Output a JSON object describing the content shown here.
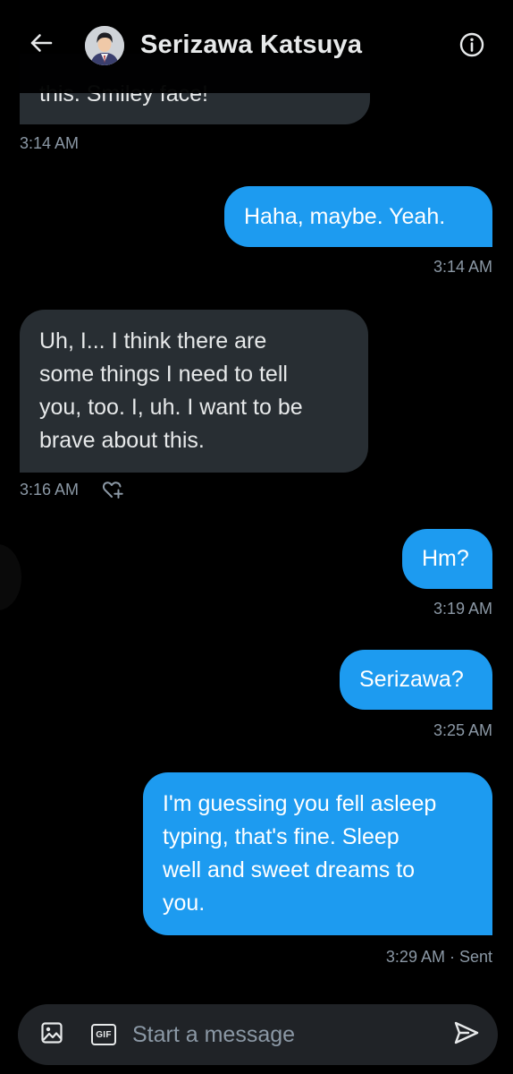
{
  "header": {
    "contact_name": "Serizawa Katsuya"
  },
  "messages": [
    {
      "direction": "received",
      "lines": [
        "this. Smiley face!"
      ],
      "time": "3:14 AM"
    },
    {
      "direction": "sent",
      "lines": [
        "Haha, maybe. Yeah."
      ],
      "time": "3:14 AM"
    },
    {
      "direction": "received",
      "lines": [
        "Uh, I... I think there are",
        "some things I need to tell",
        "you, too. I, uh. I want to be",
        "brave about this."
      ],
      "time": "3:16 AM"
    },
    {
      "direction": "sent",
      "lines": [
        "Hm?"
      ],
      "time": "3:19 AM"
    },
    {
      "direction": "sent",
      "lines": [
        "Serizawa?"
      ],
      "time": "3:25 AM"
    },
    {
      "direction": "sent",
      "lines": [
        "I'm guessing you fell asleep",
        "typing, that's fine. Sleep",
        "well and sweet dreams to",
        "you."
      ],
      "time": "3:29 AM · Sent"
    }
  ],
  "composer": {
    "placeholder": "Start a message",
    "gif_label": "GIF"
  },
  "icons": {
    "back": "arrow-left-icon",
    "info": "info-icon",
    "react": "heart-plus-icon",
    "image": "image-icon",
    "gif": "gif-icon",
    "send": "send-icon"
  },
  "colors": {
    "background": "#000000",
    "sent_bubble": "#1d9bf0",
    "received_bubble": "#282e33",
    "timestamp": "#8b98a5",
    "composer": "#202327"
  }
}
